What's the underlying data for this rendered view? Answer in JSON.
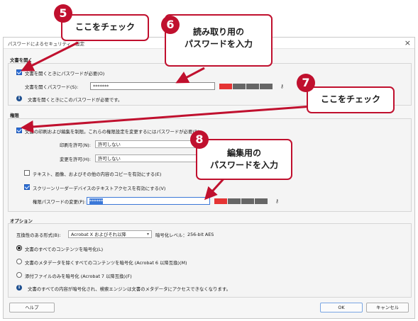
{
  "dialog": {
    "title": "パスワードによるセキュリティ - 設定",
    "close_glyph": "×"
  },
  "open_section": {
    "title": "文書を開く",
    "require_checkbox_label": "文書を開くときにパスワードが必要(O)",
    "require_checked": true,
    "password_label": "文書を開くパスワード(S):",
    "password_value": "*******",
    "strength_level": 1,
    "info_text": "文書を開くときにこのパスワードが必要です。"
  },
  "permissions_section": {
    "title": "権限",
    "restrict_checkbox_label": "文書の印刷および編集を制限。これらの権限設定を変更するにはパスワードが必要(R)",
    "restrict_checked": true,
    "print_label": "印刷を許可(N):",
    "print_value": "許可しない",
    "change_label": "変更を許可(H):",
    "change_value": "許可しない",
    "copy_checkbox_label": "テキスト、画像、およびその他の内容のコピーを有効にする(E)",
    "copy_checked": false,
    "screenreader_checkbox_label": "スクリーンリーダーデバイスのテキストアクセスを有効にする(V)",
    "screenreader_checked": true,
    "perm_password_label": "権限パスワードの変更(P):",
    "perm_password_value": "******",
    "strength_level": 1
  },
  "options_section": {
    "title": "オプション",
    "compat_label": "互換性のある形式(B):",
    "compat_value": "Acrobat X およびそれ以降",
    "encryption_label": "暗号化レベル：",
    "encryption_value": "256-bit AES",
    "radio_all": "文書のすべてのコンテンツを暗号化(L)",
    "radio_except_metadata": "文書のメタデータを除くすべてのコンテンツを暗号化 (Acrobat 6 以降互換)(M)",
    "radio_attachments": "添付ファイルのみを暗号化 (Acrobat 7 以降互換)(F)",
    "selected_radio": 0,
    "info_text": "文書のすべての内容が暗号化され、検索エンジンは文書のメタデータにアクセスできなくなります。"
  },
  "footer": {
    "help_label": "ヘルプ",
    "ok_label": "OK",
    "cancel_label": "キャンセル"
  },
  "annotations": [
    {
      "number": "5",
      "text": "ここをチェック"
    },
    {
      "number": "6",
      "text_line1": "読み取り用の",
      "text_line2": "パスワードを入力"
    },
    {
      "number": "7",
      "text": "ここをチェック"
    },
    {
      "number": "8",
      "text_line1": "編集用の",
      "text_line2": "パスワードを入力"
    }
  ],
  "colors": {
    "annotation_red": "#c0102e",
    "strength_red": "#e53434",
    "strength_gray": "#666666",
    "accent_blue": "#3b78d8"
  }
}
